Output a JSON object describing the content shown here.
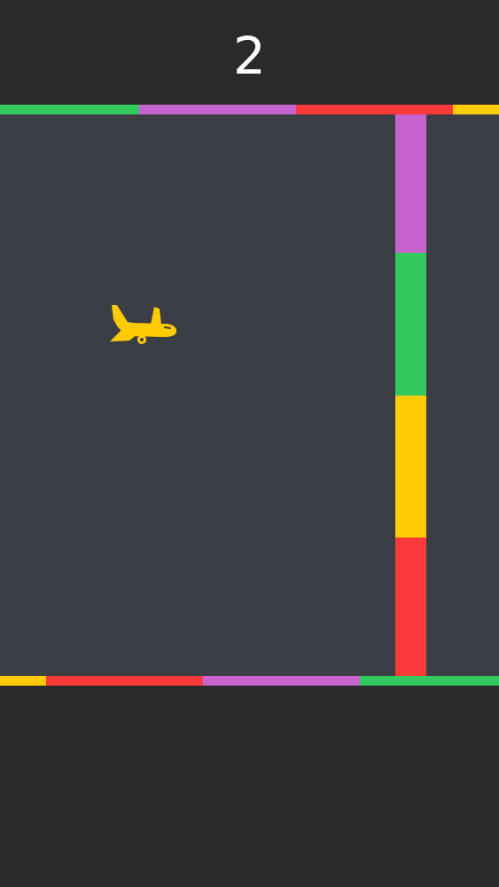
{
  "score": "2",
  "colors": {
    "background": "#2a292b",
    "playfield": "#3b3e45",
    "green": "#33c95f",
    "purple": "#c763ce",
    "red": "#fa393b",
    "yellow": "#fecb05",
    "score_text": "#ffffff"
  },
  "player": {
    "icon": "airplane-icon",
    "color": "#fecb05"
  },
  "top_wall_colors": [
    "#33c95f",
    "#c763ce",
    "#fa393b",
    "#fecb05"
  ],
  "bottom_wall_colors": [
    "#fecb05",
    "#fa393b",
    "#c763ce",
    "#33c95f"
  ],
  "pillar_colors": [
    "#c763ce",
    "#33c95f",
    "#fecb05",
    "#fa393b"
  ]
}
